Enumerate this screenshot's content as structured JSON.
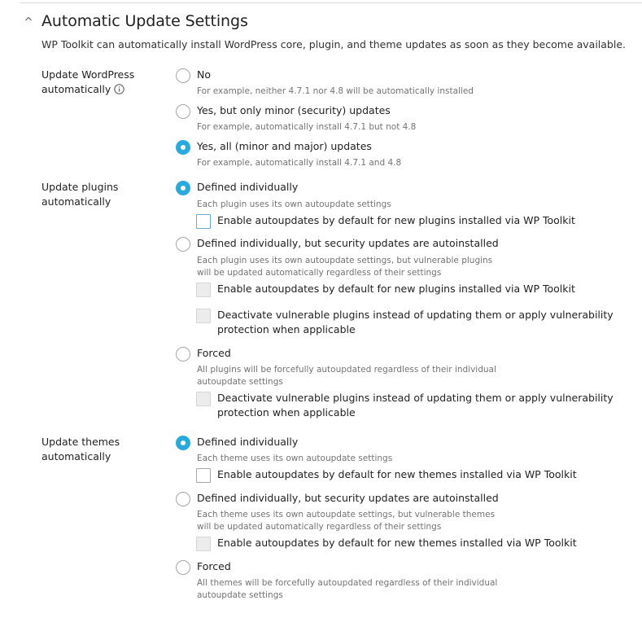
{
  "section": {
    "title": "Automatic Update Settings",
    "description": "WP Toolkit can automatically install WordPress core, plugin, and theme updates as soon as they become available."
  },
  "wordpress": {
    "label": "Update WordPress automatically",
    "options": [
      {
        "label": "No",
        "hint": "For example, neither 4.7.1 nor 4.8 will be automatically installed",
        "selected": false
      },
      {
        "label": "Yes, but only minor (security) updates",
        "hint": "For example, automatically install 4.7.1 but not 4.8",
        "selected": false
      },
      {
        "label": "Yes, all (minor and major) updates",
        "hint": "For example, automatically install 4.7.1 and 4.8",
        "selected": true
      }
    ]
  },
  "plugins": {
    "label": "Update plugins automatically",
    "options": [
      {
        "label": "Defined individually",
        "hint": "Each plugin uses its own autoupdate settings",
        "selected": true,
        "checkboxes": [
          {
            "label": "Enable autoupdates by default for new plugins installed via WP Toolkit",
            "checked": false,
            "disabled": false
          }
        ]
      },
      {
        "label": "Defined individually, but security updates are autoinstalled",
        "hint": [
          "Each plugin uses its own autoupdate settings, but vulnerable plugins",
          "will be updated automatically regardless of their settings"
        ],
        "selected": false,
        "checkboxes": [
          {
            "label": "Enable autoupdates by default for new plugins installed via WP Toolkit",
            "checked": false,
            "disabled": true
          },
          {
            "label": [
              "Deactivate vulnerable plugins instead of updating them or apply vulnerability",
              "protection when applicable"
            ],
            "checked": false,
            "disabled": true
          }
        ]
      },
      {
        "label": "Forced",
        "hint": [
          "All plugins will be forcefully autoupdated regardless of their individual",
          "autoupdate settings"
        ],
        "selected": false,
        "checkboxes": [
          {
            "label": [
              "Deactivate vulnerable plugins instead of updating them or apply vulnerability",
              "protection when applicable"
            ],
            "checked": false,
            "disabled": true
          }
        ]
      }
    ]
  },
  "themes": {
    "label": "Update themes automatically",
    "options": [
      {
        "label": "Defined individually",
        "hint": "Each theme uses its own autoupdate settings",
        "selected": true,
        "checkboxes": [
          {
            "label": "Enable autoupdates by default for new themes installed via WP Toolkit",
            "checked": false,
            "disabled": false
          }
        ]
      },
      {
        "label": "Defined individually, but security updates are autoinstalled",
        "hint": [
          "Each theme uses its own autoupdate settings, but vulnerable themes",
          "will be updated automatically regardless of their settings"
        ],
        "selected": false,
        "checkboxes": [
          {
            "label": "Enable autoupdates by default for new themes installed via WP Toolkit",
            "checked": false,
            "disabled": true
          }
        ]
      },
      {
        "label": "Forced",
        "hint": [
          "All themes will be forcefully autoupdated regardless of their individual",
          "autoupdate settings"
        ],
        "selected": false
      }
    ]
  },
  "icons": {
    "collapse": "chevron-up-icon",
    "info": "info-icon"
  },
  "colors": {
    "accent": "#28aade",
    "hint_text": "#737373",
    "divider": "#d9d9d9"
  }
}
